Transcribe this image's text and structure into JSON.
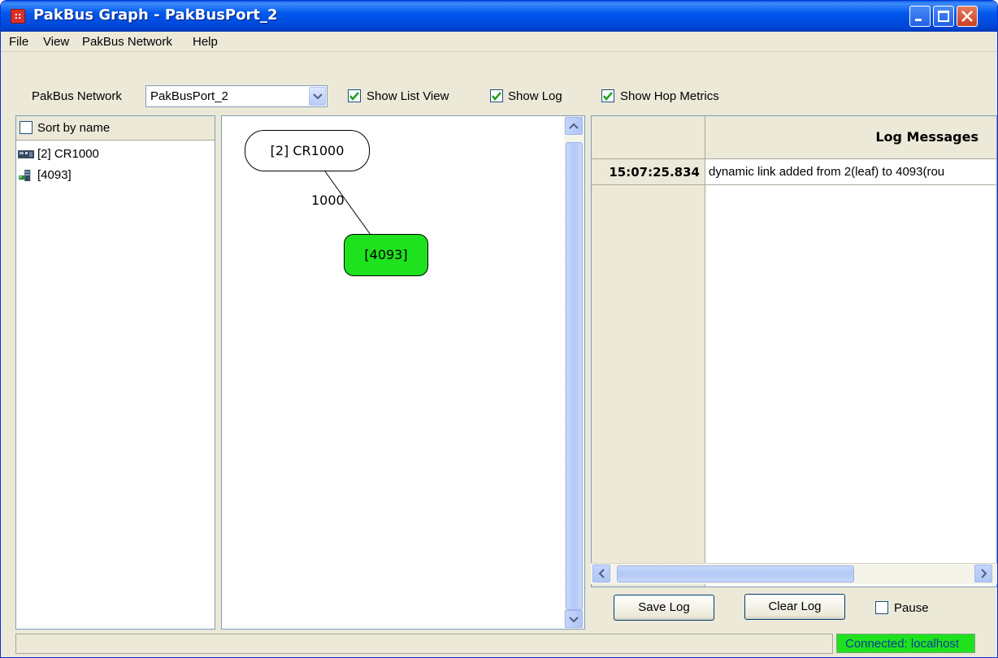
{
  "window": {
    "title": "PakBus Graph - PakBusPort_2"
  },
  "menu": [
    "File",
    "View",
    "PakBus Network",
    "Help"
  ],
  "toolbar": {
    "network_label": "PakBus Network",
    "network_value": "PakBusPort_2",
    "show_list_view": {
      "label": "Show List View",
      "checked": true
    },
    "show_log": {
      "label": "Show Log",
      "checked": true
    },
    "show_hop_metrics": {
      "label": "Show Hop Metrics",
      "checked": true
    }
  },
  "list_view": {
    "sort_label": "Sort by name",
    "sort_checked": false,
    "items": [
      {
        "label": "[2] CR1000",
        "icon": "datalogger-icon"
      },
      {
        "label": "[4093]",
        "icon": "router-icon"
      }
    ]
  },
  "graph": {
    "nodes": [
      {
        "label": "[2] CR1000",
        "color": "#ffffff"
      },
      {
        "label": "[4093]",
        "color": "#1ee21e"
      }
    ],
    "links": [
      {
        "label": "1000"
      }
    ]
  },
  "log": {
    "header": "Log Messages",
    "rows": [
      {
        "time": "15:07:25.834",
        "message": "dynamic link added from 2(leaf) to 4093(rou"
      }
    ],
    "save_label": "Save Log",
    "clear_label": "Clear Log",
    "pause_label": "Pause",
    "pause_checked": false
  },
  "status": {
    "connection": "Connected: localhost",
    "connection_color": "#1ee21e"
  }
}
